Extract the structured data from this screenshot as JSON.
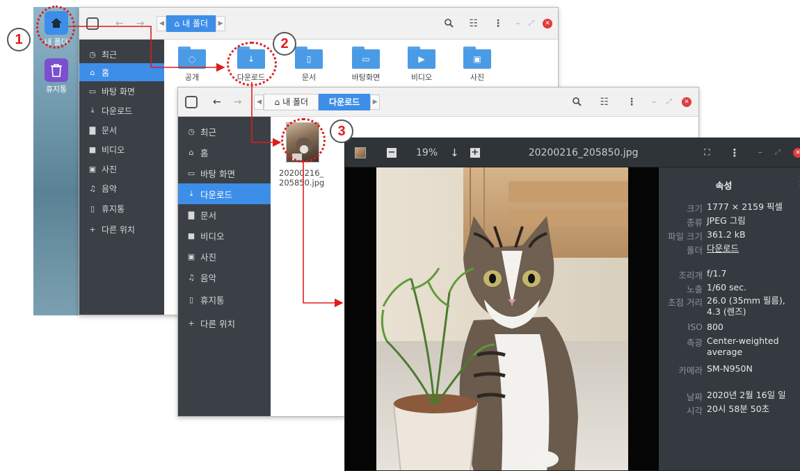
{
  "desktop": {
    "home_icon_label": "내 폴더",
    "trash_icon_label": "휴지통"
  },
  "window1": {
    "breadcrumb": "내 폴더",
    "sidebar": [
      "최근",
      "홈",
      "바탕 화면",
      "다운로드",
      "문서",
      "비디오",
      "사진",
      "음악",
      "휴지통",
      "다른 위치"
    ],
    "active_item": "홈",
    "folders": [
      "공개",
      "다운로드",
      "문서",
      "바탕화면",
      "비디오",
      "사진"
    ]
  },
  "window2": {
    "breadcrumb_home": "내 폴더",
    "breadcrumb_current": "다운로드",
    "sidebar": [
      "최근",
      "홈",
      "바탕 화면",
      "다운로드",
      "문서",
      "비디오",
      "사진",
      "음악",
      "휴지통",
      "다른 위치"
    ],
    "active_item": "다운로드",
    "file_name_line1": "20200216_",
    "file_name_line2": "205850.jpg"
  },
  "viewer": {
    "zoom": "19%",
    "filename": "20200216_205850.jpg",
    "panel_title": "속성",
    "close": "×",
    "properties": [
      {
        "label": "크기",
        "value": "1777 × 2159 픽셀"
      },
      {
        "label": "종류",
        "value": "JPEG 그림"
      },
      {
        "label": "파일 크기",
        "value": "361.2 kB"
      },
      {
        "label": "폴더",
        "value": "다운로드"
      },
      {
        "label": "조리개",
        "value": "f/1.7"
      },
      {
        "label": "노출",
        "value": "1/60 sec."
      },
      {
        "label": "초점 거리",
        "value": "26.0 (35mm 필름),\n4.3 (렌즈)"
      },
      {
        "label": "ISO",
        "value": "800"
      },
      {
        "label": "측광",
        "value": "Center-weighted\naverage"
      },
      {
        "label": "카메라",
        "value": "SM-N950N"
      },
      {
        "label": "날짜",
        "value": "2020년 2월 16일 일"
      },
      {
        "label": "시각",
        "value": "20시 58분 50초"
      }
    ]
  },
  "annotations": [
    "1",
    "2",
    "3"
  ],
  "colors": {
    "accent": "#3d8ee8",
    "sidebar": "#3b4046",
    "annotation": "#e01b1b"
  }
}
